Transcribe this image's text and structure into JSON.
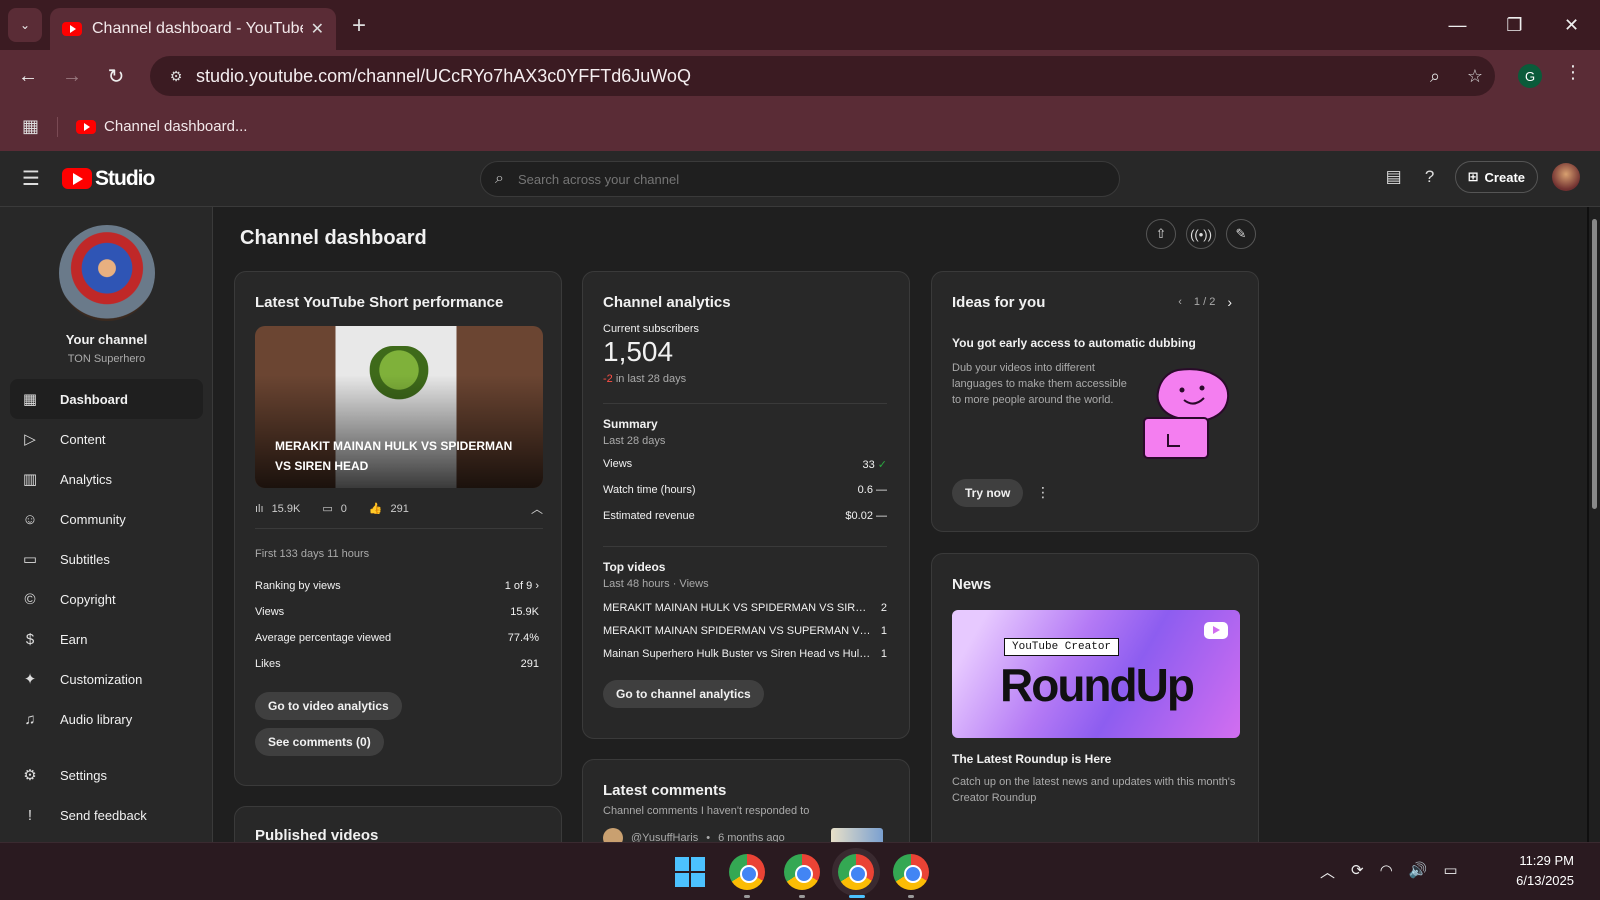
{
  "browser": {
    "tab_title": "Channel dashboard - YouTube Studio",
    "url": "studio.youtube.com/channel/UCcRYo7hAX3c0YFFTd6JuWoQ",
    "bookmark_label": "Channel dashboard...",
    "profile_initial": "G"
  },
  "studio": {
    "logo_text": "Studio",
    "search_placeholder": "Search across your channel",
    "create_label": "Create"
  },
  "sidebar": {
    "channel_title": "Your channel",
    "channel_name": "TON Superhero",
    "items": [
      {
        "label": "Dashboard",
        "icon": "dashboard-icon",
        "active": true
      },
      {
        "label": "Content",
        "icon": "content-icon"
      },
      {
        "label": "Analytics",
        "icon": "analytics-icon"
      },
      {
        "label": "Community",
        "icon": "community-icon"
      },
      {
        "label": "Subtitles",
        "icon": "subtitles-icon"
      },
      {
        "label": "Copyright",
        "icon": "copyright-icon"
      },
      {
        "label": "Earn",
        "icon": "dollar-icon"
      },
      {
        "label": "Customization",
        "icon": "magic-wand-icon"
      },
      {
        "label": "Audio library",
        "icon": "audio-library-icon"
      }
    ],
    "bottom_items": [
      {
        "label": "Settings",
        "icon": "gear-icon"
      },
      {
        "label": "Send feedback",
        "icon": "feedback-icon"
      }
    ]
  },
  "main": {
    "page_title": "Channel dashboard",
    "short_perf": {
      "title": "Latest YouTube Short performance",
      "video_title": "MERAKIT MAINAN HULK VS SPIDERMAN VS SIREN HEAD",
      "views_stat": "15.9K",
      "comments_stat": "0",
      "likes_stat": "291",
      "period": "First 133 days 11 hours",
      "rows": [
        {
          "label": "Ranking by views",
          "value": "1 of 9"
        },
        {
          "label": "Views",
          "value": "15.9K"
        },
        {
          "label": "Average percentage viewed",
          "value": "77.4%"
        },
        {
          "label": "Likes",
          "value": "291"
        }
      ],
      "btn_analytics": "Go to video analytics",
      "btn_comments": "See comments (0)"
    },
    "analytics": {
      "title": "Channel analytics",
      "subs_label": "Current subscribers",
      "subs_value": "1,504",
      "subs_change": "-2",
      "subs_change_suffix": "in last 28 days",
      "summary_title": "Summary",
      "summary_period": "Last 28 days",
      "summary_rows": [
        {
          "label": "Views",
          "value": "33",
          "trend": "✓"
        },
        {
          "label": "Watch time (hours)",
          "value": "0.6",
          "trend": "—"
        },
        {
          "label": "Estimated revenue",
          "value": "$0.02",
          "trend": "—"
        }
      ],
      "top_title": "Top videos",
      "top_period": "Last 48 hours · Views",
      "top_videos": [
        {
          "name": "MERAKIT MAINAN HULK VS SPIDERMAN VS SIREN HEAD",
          "views": "2"
        },
        {
          "name": "MERAKIT MAINAN SPIDERMAN VS SUPERMAN VS HULK",
          "views": "1"
        },
        {
          "name": "Mainan Superhero Hulk Buster vs Siren Head vs Hulk Smash",
          "views": "1"
        }
      ],
      "btn": "Go to channel analytics"
    },
    "ideas": {
      "title": "Ideas for you",
      "pager": "1 / 2",
      "headline": "You got early access to automatic dubbing",
      "body": "Dub your videos into different languages to make them accessible to more people around the world.",
      "btn": "Try now"
    },
    "news": {
      "title": "News",
      "badge": "YouTube Creator",
      "big": "RoundUp",
      "headline": "The Latest Roundup is Here",
      "body": "Catch up on the latest news and updates with this month's Creator Roundup"
    },
    "published": {
      "title": "Published videos"
    },
    "comments": {
      "title": "Latest comments",
      "subtitle": "Channel comments I haven't responded to",
      "first_author": "@YusuffHaris",
      "first_time": "6 months ago"
    }
  },
  "taskbar": {
    "time": "11:29 PM",
    "date": "6/13/2025"
  }
}
